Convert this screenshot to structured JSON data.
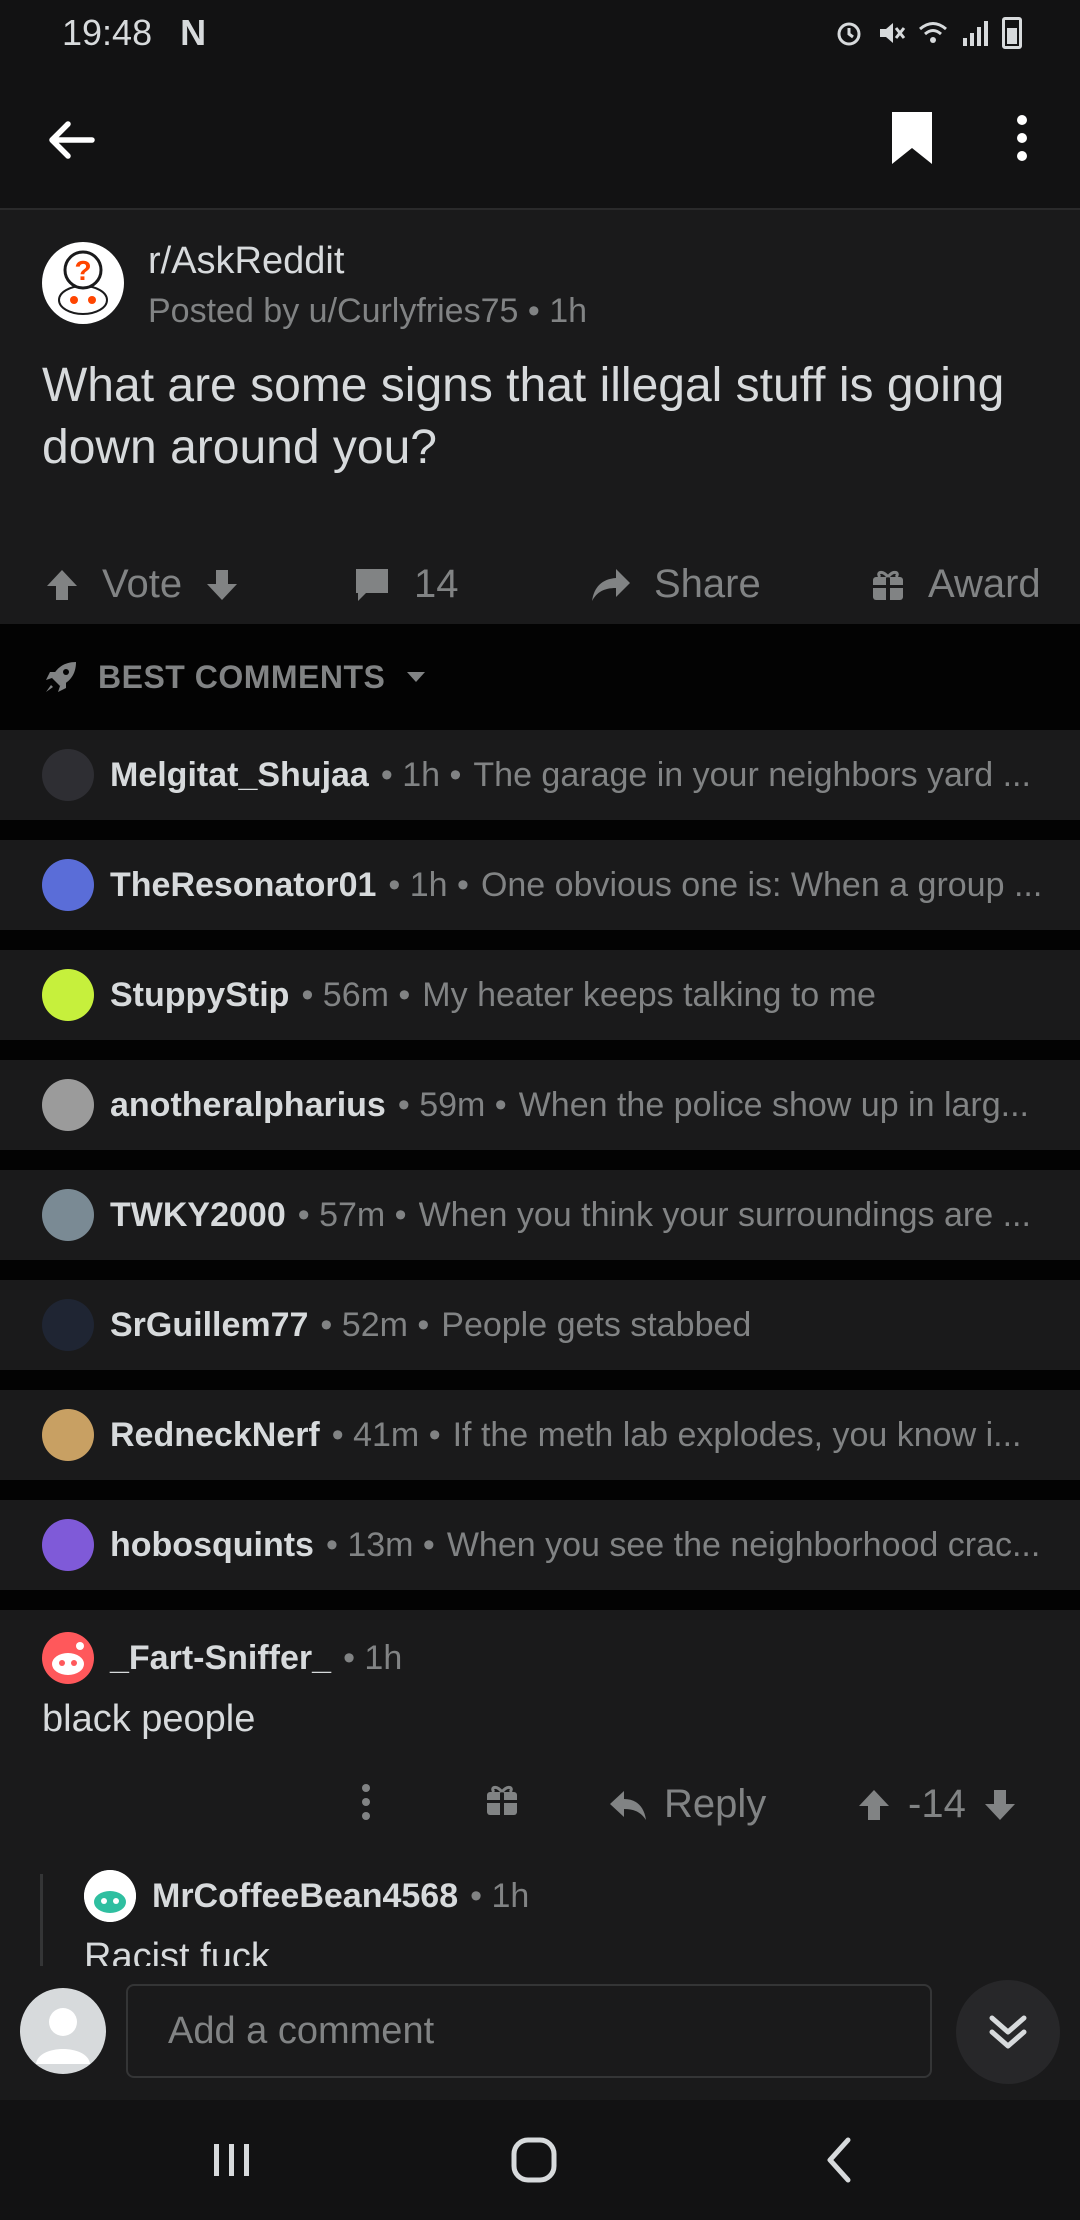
{
  "status": {
    "time": "19:48",
    "notification": "N"
  },
  "post": {
    "subreddit": "r/AskReddit",
    "posted_by": "Posted by u/Curlyfries75 • 1h",
    "title": "What are some signs that illegal stuff is going down around you?",
    "vote_label": "Vote",
    "comment_count": "14",
    "share_label": "Share",
    "award_label": "Award"
  },
  "sort": {
    "label": "BEST COMMENTS"
  },
  "collapsed_comments": [
    {
      "user": "Melgitat_Shujaa",
      "age": "1h",
      "text": "The garage in your neighbors yard ...",
      "avatar_color": "#2e2e33"
    },
    {
      "user": "TheResonator01",
      "age": "1h",
      "text": "One obvious one is: When a group ...",
      "avatar_color": "#5a6dd8"
    },
    {
      "user": "StuppyStip",
      "age": "56m",
      "text": "My heater keeps talking to me",
      "avatar_color": "#c6f03c"
    },
    {
      "user": "anotheralpharius",
      "age": "59m",
      "text": "When the police show up in larg...",
      "avatar_color": "#9b9b9b"
    },
    {
      "user": "TWKY2000",
      "age": "57m",
      "text": "When you think your surroundings are ...",
      "avatar_color": "#7a8a94"
    },
    {
      "user": "SrGuillem77",
      "age": "52m",
      "text": "People gets stabbed",
      "avatar_color": "#1f2533"
    },
    {
      "user": "RedneckNerf",
      "age": "41m",
      "text": "If the meth lab explodes, you know i...",
      "avatar_color": "#c8a063"
    },
    {
      "user": "hobosquints",
      "age": "13m",
      "text": "When you see the neighborhood crac...",
      "avatar_color": "#7f5ad8"
    }
  ],
  "main_comment": {
    "user": "_Fart-Sniffer_",
    "age": "1h",
    "body": "black people",
    "reply_label": "Reply",
    "score": "-14"
  },
  "reply": {
    "user": "MrCoffeeBean4568",
    "age": "1h",
    "body": "Racist fuck"
  },
  "comment_bar": {
    "placeholder": "Add a comment"
  },
  "colors": {
    "background": "#1a1a1b",
    "text": "#d7dadc",
    "muted": "#818384",
    "accent": "#ff4500"
  }
}
